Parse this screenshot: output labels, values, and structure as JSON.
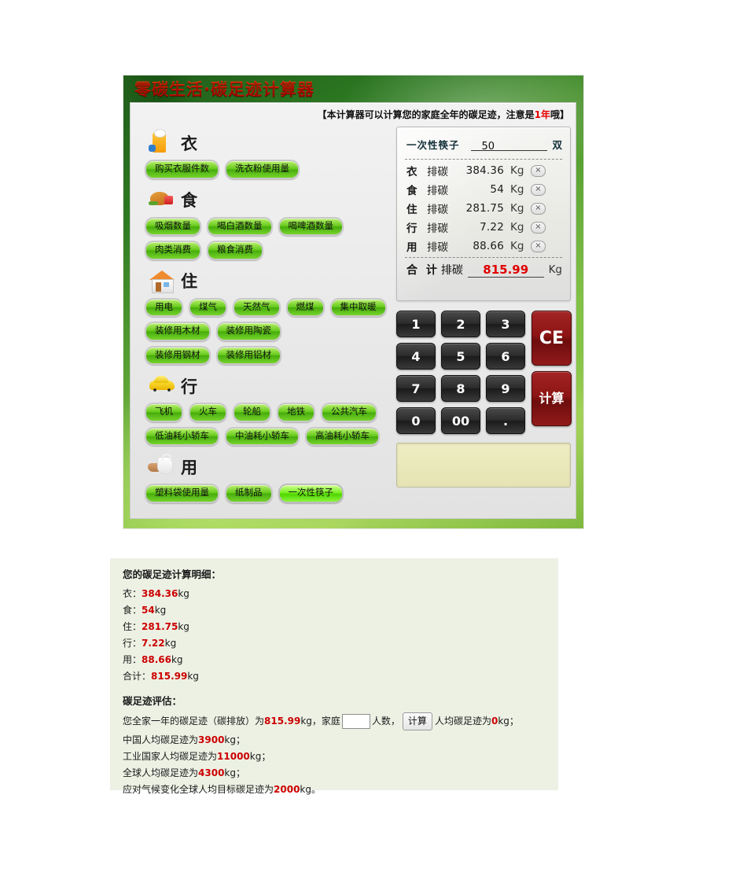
{
  "app": {
    "title": "零碳生活·碳足迹计算器",
    "notice_prefix": "【本计算器可以计算您的家庭全年的碳足迹，注意是",
    "notice_highlight": "1年",
    "notice_suffix": "哦】"
  },
  "categories": [
    {
      "icon": "clothing-icon",
      "title": "衣",
      "items": [
        {
          "label": "购买衣服件数",
          "active": false
        },
        {
          "label": "洗衣粉使用量",
          "active": false
        }
      ]
    },
    {
      "icon": "food-icon",
      "title": "食",
      "items": [
        {
          "label": "吸烟数量",
          "active": false
        },
        {
          "label": "喝白酒数量",
          "active": false
        },
        {
          "label": "喝啤酒数量",
          "active": false
        },
        {
          "label": "肉类消费",
          "active": false
        },
        {
          "label": "粮食消费",
          "active": false
        }
      ]
    },
    {
      "icon": "house-icon",
      "title": "住",
      "items": [
        {
          "label": "用电",
          "active": false
        },
        {
          "label": "煤气",
          "active": false
        },
        {
          "label": "天然气",
          "active": false
        },
        {
          "label": "燃煤",
          "active": false
        },
        {
          "label": "集中取暖",
          "active": false
        },
        {
          "label": "装修用木材",
          "active": false
        },
        {
          "label": "装修用陶瓷",
          "active": false
        },
        {
          "label": "装修用钢材",
          "active": false
        },
        {
          "label": "装修用铝材",
          "active": false
        }
      ]
    },
    {
      "icon": "car-icon",
      "title": "行",
      "items": [
        {
          "label": "飞机",
          "active": false
        },
        {
          "label": "火车",
          "active": false
        },
        {
          "label": "轮船",
          "active": false
        },
        {
          "label": "地铁",
          "active": false
        },
        {
          "label": "公共汽车",
          "active": false
        },
        {
          "label": "低油耗小轿车",
          "active": false
        },
        {
          "label": "中油耗小轿车",
          "active": false
        },
        {
          "label": "高油耗小轿车",
          "active": false
        }
      ]
    },
    {
      "icon": "plastic-bag-icon",
      "title": "用",
      "items": [
        {
          "label": "塑料袋使用量",
          "active": false
        },
        {
          "label": "纸制品",
          "active": false
        },
        {
          "label": "一次性筷子",
          "active": true
        }
      ]
    }
  ],
  "result": {
    "current_label": "一次性筷子",
    "current_value": "50",
    "current_unit": "双",
    "emission_label": "排碳",
    "unit": "Kg",
    "clear_symbol": "×",
    "rows": [
      {
        "cat": "衣",
        "label": "排碳",
        "value": "384.36",
        "unit": "Kg"
      },
      {
        "cat": "食",
        "label": "排碳",
        "value": "54",
        "unit": "Kg"
      },
      {
        "cat": "住",
        "label": "排碳",
        "value": "281.75",
        "unit": "Kg"
      },
      {
        "cat": "行",
        "label": "排碳",
        "value": "7.22",
        "unit": "Kg"
      },
      {
        "cat": "用",
        "label": "排碳",
        "value": "88.66",
        "unit": "Kg"
      }
    ],
    "total": {
      "label": "合 计",
      "label2": "排碳",
      "value": "815.99",
      "unit": "Kg"
    }
  },
  "keypad": {
    "keys": [
      "1",
      "2",
      "3",
      "4",
      "5",
      "6",
      "7",
      "8",
      "9",
      "0",
      "00",
      "."
    ],
    "clear_label": "CE",
    "calc_label": "计算",
    "display_value": ""
  },
  "report": {
    "detail_heading": "您的碳足迹计算明细：",
    "details": [
      {
        "label": "衣：",
        "value": "384.36",
        "unit": "kg"
      },
      {
        "label": "食：",
        "value": "54",
        "unit": "kg"
      },
      {
        "label": "住：",
        "value": "281.75",
        "unit": "kg"
      },
      {
        "label": "行：",
        "value": "7.22",
        "unit": "kg"
      },
      {
        "label": "用：",
        "value": "88.66",
        "unit": "kg"
      },
      {
        "label": "合计：",
        "value": "815.99",
        "unit": "kg"
      }
    ],
    "eval_heading": "碳足迹评估：",
    "eval_line1_a": "您全家一年的碳足迹（碳排放）为",
    "eval_line1_total": "815.99",
    "eval_line1_b": "kg，家庭",
    "eval_people_value": "",
    "eval_line1_c": "人数，",
    "eval_button": "计算",
    "eval_line1_d": "人均碳足迹为",
    "eval_percap_value": "0",
    "eval_line1_e": "kg；",
    "comparisons": [
      {
        "prefix": "中国人均碳足迹为",
        "value": "3900",
        "suffix": "kg；"
      },
      {
        "prefix": "工业国家人均碳足迹为",
        "value": "11000",
        "suffix": "kg；"
      },
      {
        "prefix": "全球人均碳足迹为",
        "value": "4300",
        "suffix": "kg；"
      },
      {
        "prefix": "应对气候变化全球人均目标碳足迹为",
        "value": "2000",
        "suffix": "kg。"
      }
    ]
  }
}
